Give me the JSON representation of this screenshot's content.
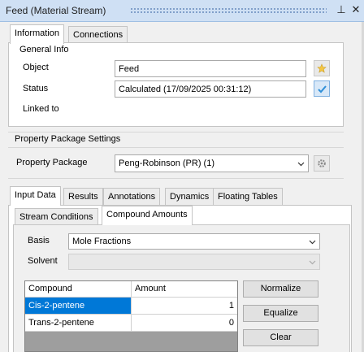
{
  "window": {
    "title": "Feed (Material Stream)",
    "pin_glyph": "⊥",
    "close_glyph": "✕"
  },
  "top_tabs": [
    {
      "label": "Information"
    },
    {
      "label": "Connections"
    }
  ],
  "general_info": {
    "title": "General Info",
    "object_label": "Object",
    "object_value": "Feed",
    "status_label": "Status",
    "status_value": "Calculated (17/09/2025 00:31:12)",
    "linked_label": "Linked to"
  },
  "property_package": {
    "section_title": "Property Package Settings",
    "label": "Property Package",
    "value": "Peng-Robinson (PR) (1)"
  },
  "input_tabs": [
    {
      "label": "Input Data"
    },
    {
      "label": "Results"
    },
    {
      "label": "Annotations"
    },
    {
      "label": "Dynamics"
    },
    {
      "label": "Floating Tables"
    }
  ],
  "sub_tabs": [
    {
      "label": "Stream Conditions"
    },
    {
      "label": "Compound Amounts"
    }
  ],
  "basis": {
    "label": "Basis",
    "value": "Mole Fractions"
  },
  "solvent": {
    "label": "Solvent",
    "value": ""
  },
  "compound_table": {
    "columns": [
      "Compound",
      "Amount"
    ],
    "rows": [
      {
        "compound": "Cis-2-pentene",
        "amount": "1"
      },
      {
        "compound": "Trans-2-pentene",
        "amount": "0"
      }
    ]
  },
  "actions": {
    "normalize": "Normalize",
    "equalize": "Equalize",
    "clear": "Clear"
  },
  "colors": {
    "titlebar": "#cfe0f4",
    "selection": "#0078d7",
    "check_accent": "#2f8fd8"
  }
}
